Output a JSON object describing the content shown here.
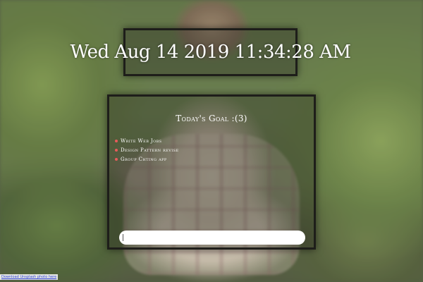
{
  "clock": {
    "text": "Wed Aug 14 2019 11:34:28 AM"
  },
  "goals": {
    "title": "Today's Goal :(3)",
    "items": [
      {
        "label": "Write Web Jobs"
      },
      {
        "label": "Design Pattern revise"
      },
      {
        "label": "Group Chting app"
      }
    ],
    "input": {
      "value": "",
      "placeholder": ""
    },
    "bullet_color": "#e85b5b"
  },
  "footer": {
    "credit_link": "Download Unsplash photo here"
  }
}
